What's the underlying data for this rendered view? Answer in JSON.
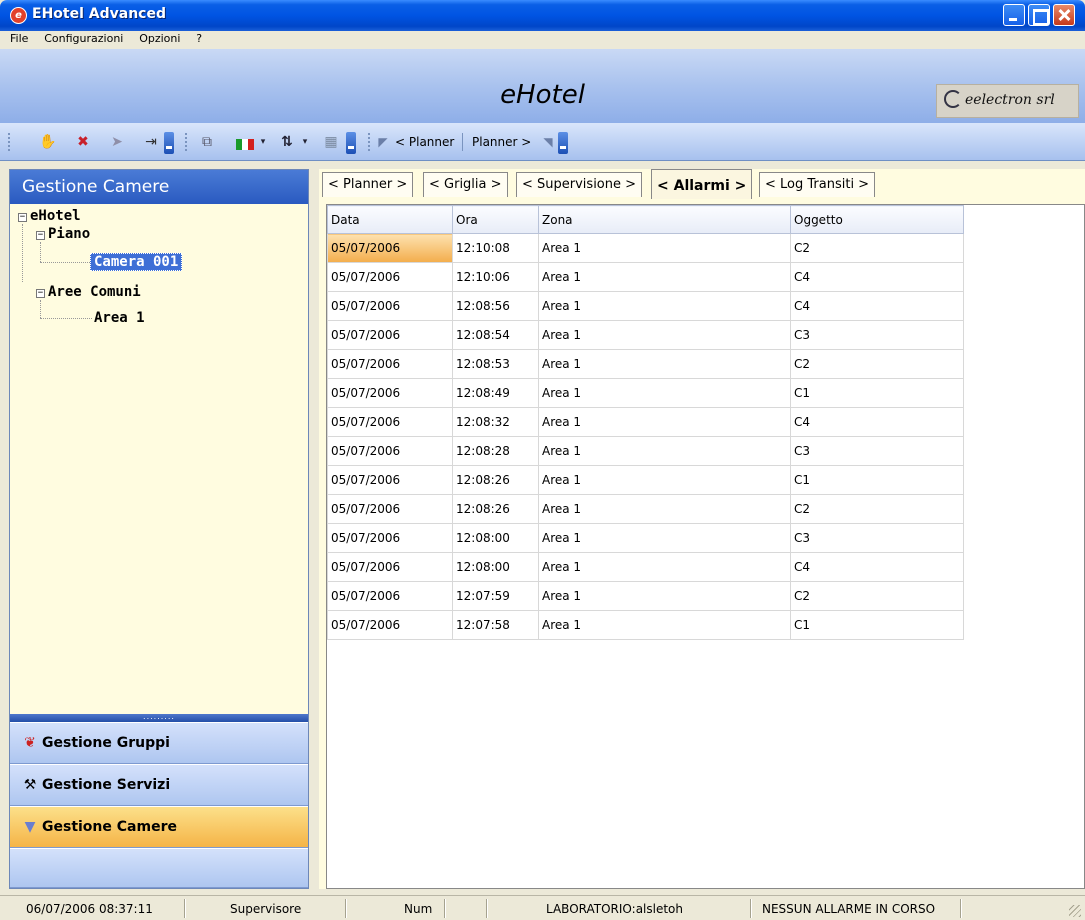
{
  "window": {
    "title": "EHotel Advanced",
    "controls": [
      "minimize",
      "maximize",
      "close"
    ]
  },
  "menu": {
    "items": [
      "File",
      "Configurazioni",
      "Opzioni",
      "?"
    ]
  },
  "banner": {
    "title": "eHotel",
    "brand": "eelectron srl"
  },
  "toolbar": {
    "planner_prev": "< Planner",
    "planner_next": "Planner >"
  },
  "left_panel": {
    "header": "Gestione Camere",
    "tree": {
      "root": "eHotel",
      "piano": "Piano",
      "camera": "Camera 001",
      "aree": "Aree Comuni",
      "area": "Area 1"
    },
    "splitter": ".........",
    "nav": [
      {
        "label": "Gestione Gruppi",
        "icon": "groups-icon"
      },
      {
        "label": "Gestione Servizi",
        "icon": "services-icon"
      },
      {
        "label": "Gestione Camere",
        "icon": "rooms-icon"
      }
    ]
  },
  "tabs": [
    {
      "label": "< Planner >"
    },
    {
      "label": "< Griglia >"
    },
    {
      "label": "< Supervisione >"
    },
    {
      "label": "< Allarmi >"
    },
    {
      "label": "< Log Transiti >"
    }
  ],
  "grid": {
    "columns": [
      "Data",
      "Ora",
      "Zona",
      "Oggetto"
    ],
    "rows": [
      [
        "05/07/2006",
        "12:10:08",
        "Area 1",
        "C2"
      ],
      [
        "05/07/2006",
        "12:10:06",
        "Area 1",
        "C4"
      ],
      [
        "05/07/2006",
        "12:08:56",
        "Area 1",
        "C4"
      ],
      [
        "05/07/2006",
        "12:08:54",
        "Area 1",
        "C3"
      ],
      [
        "05/07/2006",
        "12:08:53",
        "Area 1",
        "C2"
      ],
      [
        "05/07/2006",
        "12:08:49",
        "Area 1",
        "C1"
      ],
      [
        "05/07/2006",
        "12:08:32",
        "Area 1",
        "C4"
      ],
      [
        "05/07/2006",
        "12:08:28",
        "Area 1",
        "C3"
      ],
      [
        "05/07/2006",
        "12:08:26",
        "Area 1",
        "C1"
      ],
      [
        "05/07/2006",
        "12:08:26",
        "Area 1",
        "C2"
      ],
      [
        "05/07/2006",
        "12:08:00",
        "Area 1",
        "C3"
      ],
      [
        "05/07/2006",
        "12:08:00",
        "Area 1",
        "C4"
      ],
      [
        "05/07/2006",
        "12:07:59",
        "Area 1",
        "C2"
      ],
      [
        "05/07/2006",
        "12:07:58",
        "Area 1",
        "C1"
      ]
    ]
  },
  "status": {
    "datetime": "06/07/2006 08:37:11",
    "user": "Supervisore",
    "num": "Num",
    "host": "LABORATORIO:alsletoh",
    "alarm": "NESSUN ALLARME IN CORSO"
  }
}
